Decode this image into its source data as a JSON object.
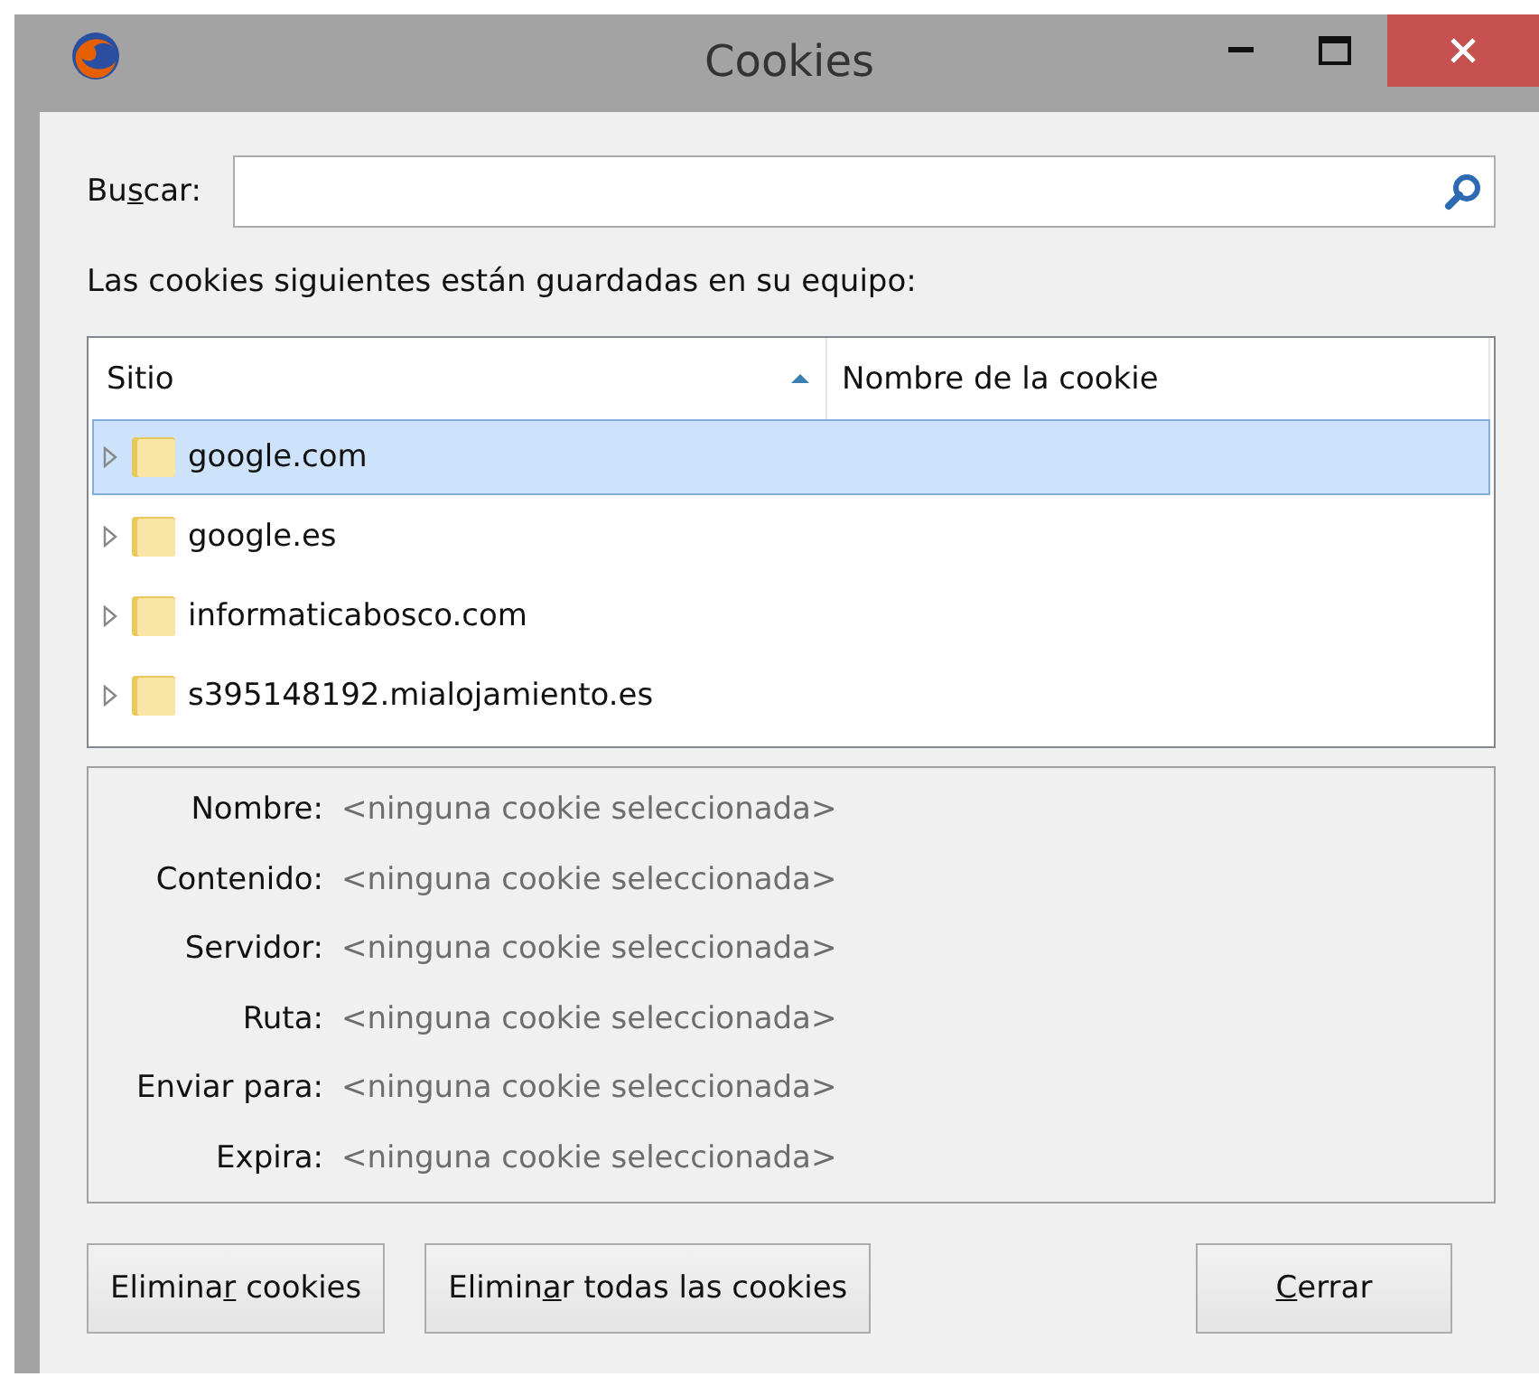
{
  "window": {
    "title": "Cookies"
  },
  "search": {
    "label_parts": {
      "before": "Bu",
      "key": "s",
      "after": "car:"
    }
  },
  "description": "Las cookies siguientes están guardadas en su equipo:",
  "table": {
    "columns": [
      {
        "label": "Sitio",
        "sorted": true
      },
      {
        "label": "Nombre de la cookie",
        "sorted": false
      }
    ],
    "rows": [
      {
        "site": "google.com",
        "selected": true,
        "expanded": false
      },
      {
        "site": "google.es",
        "selected": false,
        "expanded": false
      },
      {
        "site": "informaticabosco.com",
        "selected": false,
        "expanded": false
      },
      {
        "site": "s395148192.mialojamiento.es",
        "selected": false,
        "expanded": false
      }
    ]
  },
  "details": [
    {
      "label": "Nombre:",
      "value": "<ninguna cookie seleccionada>"
    },
    {
      "label": "Contenido:",
      "value": "<ninguna cookie seleccionada>"
    },
    {
      "label": "Servidor:",
      "value": "<ninguna cookie seleccionada>"
    },
    {
      "label": "Ruta:",
      "value": "<ninguna cookie seleccionada>"
    },
    {
      "label": "Enviar para:",
      "value": "<ninguna cookie seleccionada>"
    },
    {
      "label": "Expira:",
      "value": "<ninguna cookie seleccionada>"
    }
  ],
  "buttons": [
    {
      "label_parts": {
        "before": "Elimina",
        "key": "r",
        "after": " cookies"
      },
      "kind": "left"
    },
    {
      "label_parts": {
        "before": "Elimin",
        "key": "a",
        "after": "r todas las cookies"
      },
      "kind": "left"
    },
    {
      "label_parts": {
        "key": "C",
        "after": "errar"
      },
      "kind": "right"
    }
  ]
}
